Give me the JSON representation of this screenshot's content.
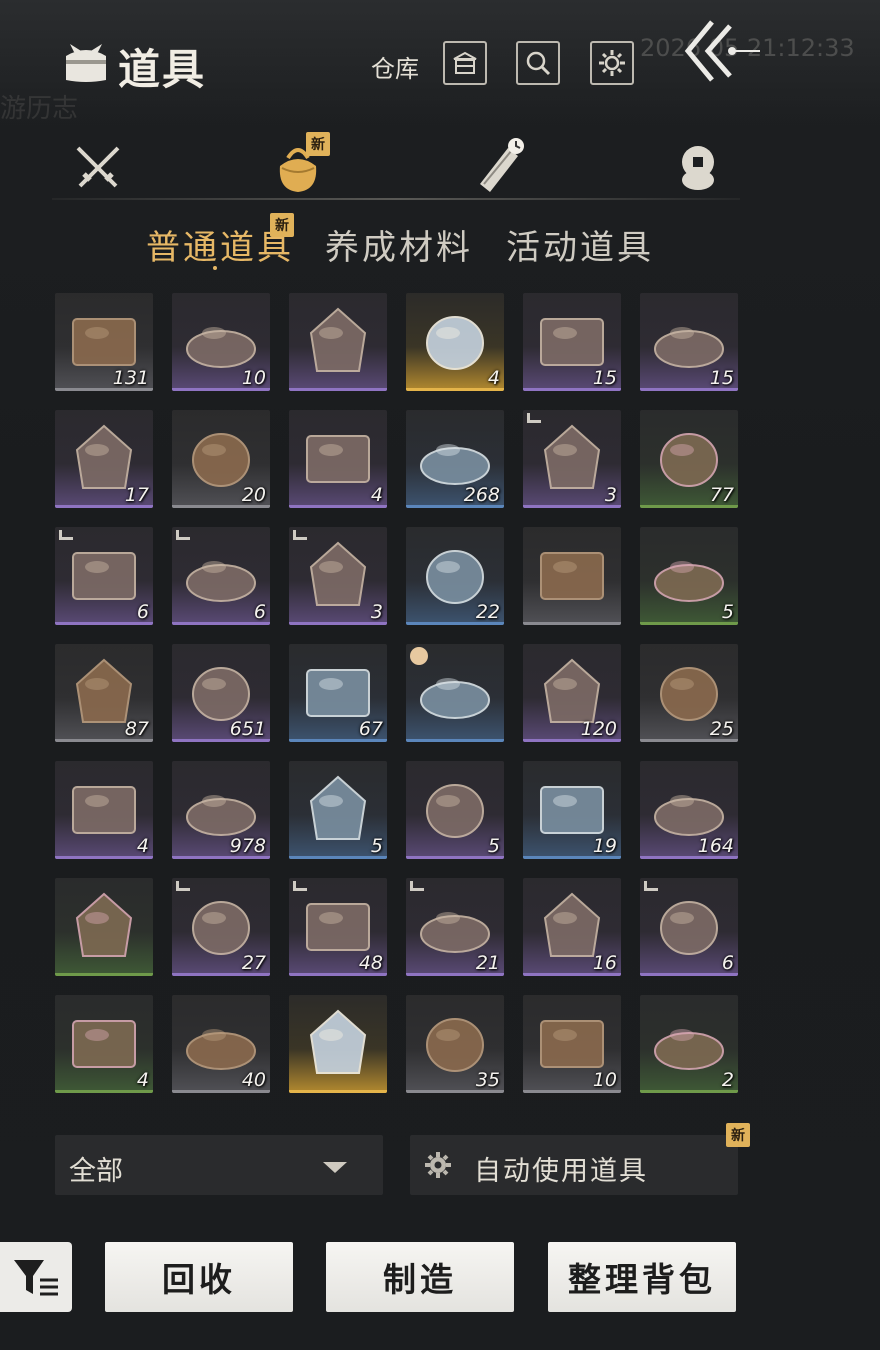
{
  "header": {
    "title": "道具",
    "warehouse_label": "仓库",
    "background_time": "2026 05 21:12:33",
    "background_labels": [
      "游历志"
    ]
  },
  "category_tabs": [
    {
      "name": "weapons",
      "icon": "crossed-swords-icon",
      "active": false
    },
    {
      "name": "items",
      "icon": "bundle-icon",
      "active": true,
      "badge": "新"
    },
    {
      "name": "scrolls",
      "icon": "scroll-clock-icon",
      "active": false
    },
    {
      "name": "tokens",
      "icon": "coin-stack-icon",
      "active": false
    }
  ],
  "sub_tabs": [
    {
      "label": "普通道具",
      "active": true,
      "badge": "新"
    },
    {
      "label": "养成材料",
      "active": false
    },
    {
      "label": "活动道具",
      "active": false
    }
  ],
  "items": [
    {
      "name": "wine-jar",
      "quality": "white",
      "count": "131"
    },
    {
      "name": "cloth-pouch",
      "quality": "purple",
      "count": "10"
    },
    {
      "name": "silk-pouch",
      "quality": "purple",
      "count": ""
    },
    {
      "name": "spirit-wisp",
      "quality": "gold",
      "count": "4"
    },
    {
      "name": "wooden-chest",
      "quality": "purple",
      "count": "15"
    },
    {
      "name": "ornate-chest",
      "quality": "purple",
      "count": "15"
    },
    {
      "name": "blue-pouch",
      "quality": "purple",
      "count": "17"
    },
    {
      "name": "arrows",
      "quality": "white",
      "count": "20"
    },
    {
      "name": "dark-horn",
      "quality": "purple",
      "count": "4"
    },
    {
      "name": "spice-box",
      "quality": "blue",
      "count": "268"
    },
    {
      "name": "cake-plate",
      "quality": "purple",
      "count": "3",
      "tag": "water"
    },
    {
      "name": "peach-blossom",
      "quality": "green",
      "count": "77"
    },
    {
      "name": "scroll-letter",
      "quality": "purple",
      "count": "6",
      "tag": "book"
    },
    {
      "name": "scroll-letter-2",
      "quality": "purple",
      "count": "6",
      "tag": "book"
    },
    {
      "name": "herb-bowl",
      "quality": "purple",
      "count": "3",
      "tag": "arrow"
    },
    {
      "name": "horn",
      "quality": "blue",
      "count": "22"
    },
    {
      "name": "iron-chest",
      "quality": "white",
      "count": ""
    },
    {
      "name": "firewood",
      "quality": "green",
      "count": "5"
    },
    {
      "name": "grain-sack",
      "quality": "white",
      "count": "87"
    },
    {
      "name": "red-chest",
      "quality": "purple",
      "count": "651"
    },
    {
      "name": "gem-box",
      "quality": "blue",
      "count": "67"
    },
    {
      "name": "gourd-vase",
      "quality": "blue",
      "count": "",
      "tag": "clock"
    },
    {
      "name": "bird-medal",
      "quality": "purple",
      "count": "120"
    },
    {
      "name": "fur-pelt",
      "quality": "white",
      "count": "25"
    },
    {
      "name": "carved-chest",
      "quality": "purple",
      "count": "4"
    },
    {
      "name": "talisman",
      "quality": "purple",
      "count": "978"
    },
    {
      "name": "teapot",
      "quality": "blue",
      "count": "5"
    },
    {
      "name": "plaque",
      "quality": "purple",
      "count": "5"
    },
    {
      "name": "jar-lid",
      "quality": "blue",
      "count": "19"
    },
    {
      "name": "red-chest-2",
      "quality": "purple",
      "count": "164"
    },
    {
      "name": "mushrooms",
      "quality": "green",
      "count": ""
    },
    {
      "name": "stew-pot",
      "quality": "purple",
      "count": "27",
      "tag": "arrow"
    },
    {
      "name": "bun-basket",
      "quality": "purple",
      "count": "48",
      "tag": "arrow"
    },
    {
      "name": "paper-letter",
      "quality": "purple",
      "count": "21",
      "tag": "book"
    },
    {
      "name": "golden-orb",
      "quality": "purple",
      "count": "16"
    },
    {
      "name": "meat-bowl",
      "quality": "purple",
      "count": "6",
      "tag": "arrow"
    },
    {
      "name": "lavender",
      "quality": "green",
      "count": "4"
    },
    {
      "name": "mushroom-pile",
      "quality": "white",
      "count": "40"
    },
    {
      "name": "moth",
      "quality": "gold",
      "count": ""
    },
    {
      "name": "eggs",
      "quality": "white",
      "count": "35"
    },
    {
      "name": "raw-meat",
      "quality": "white",
      "count": "10"
    },
    {
      "name": "plain-pouch",
      "quality": "green",
      "count": "2"
    }
  ],
  "filter_dropdown": {
    "value": "全部"
  },
  "auto_use": {
    "label": "自动使用道具",
    "badge": "新"
  },
  "actions": {
    "recycle": "回收",
    "craft": "制造",
    "sort": "整理背包"
  }
}
